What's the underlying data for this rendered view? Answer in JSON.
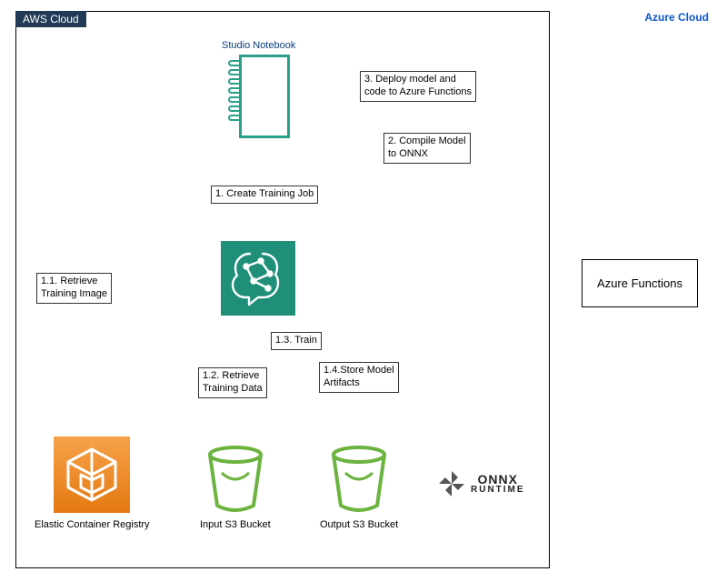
{
  "clouds": {
    "aws": "AWS Cloud",
    "azure": "Azure Cloud"
  },
  "nodes": {
    "notebook": "Studio Notebook",
    "sagemaker": "",
    "ecr": "Elastic Container Registry",
    "input_bucket": "Input S3 Bucket",
    "output_bucket": "Output S3 Bucket",
    "onnx_name": "ONNX",
    "onnx_sub": "RUNTIME",
    "azure_fn": "Azure Functions"
  },
  "steps": {
    "s1": "1. Create Training Job",
    "s1_1_a": "1.1. Retrieve",
    "s1_1_b": "Training Image",
    "s1_2_a": "1.2. Retrieve",
    "s1_2_b": "Training Data",
    "s1_3": "1.3. Train",
    "s1_4_a": "1.4.Store Model",
    "s1_4_b": "Artifacts",
    "s2_a": "2. Compile Model",
    "s2_b": "to ONNX",
    "s3_a": "3. Deploy model and",
    "s3_b": "code to Azure Functions"
  }
}
